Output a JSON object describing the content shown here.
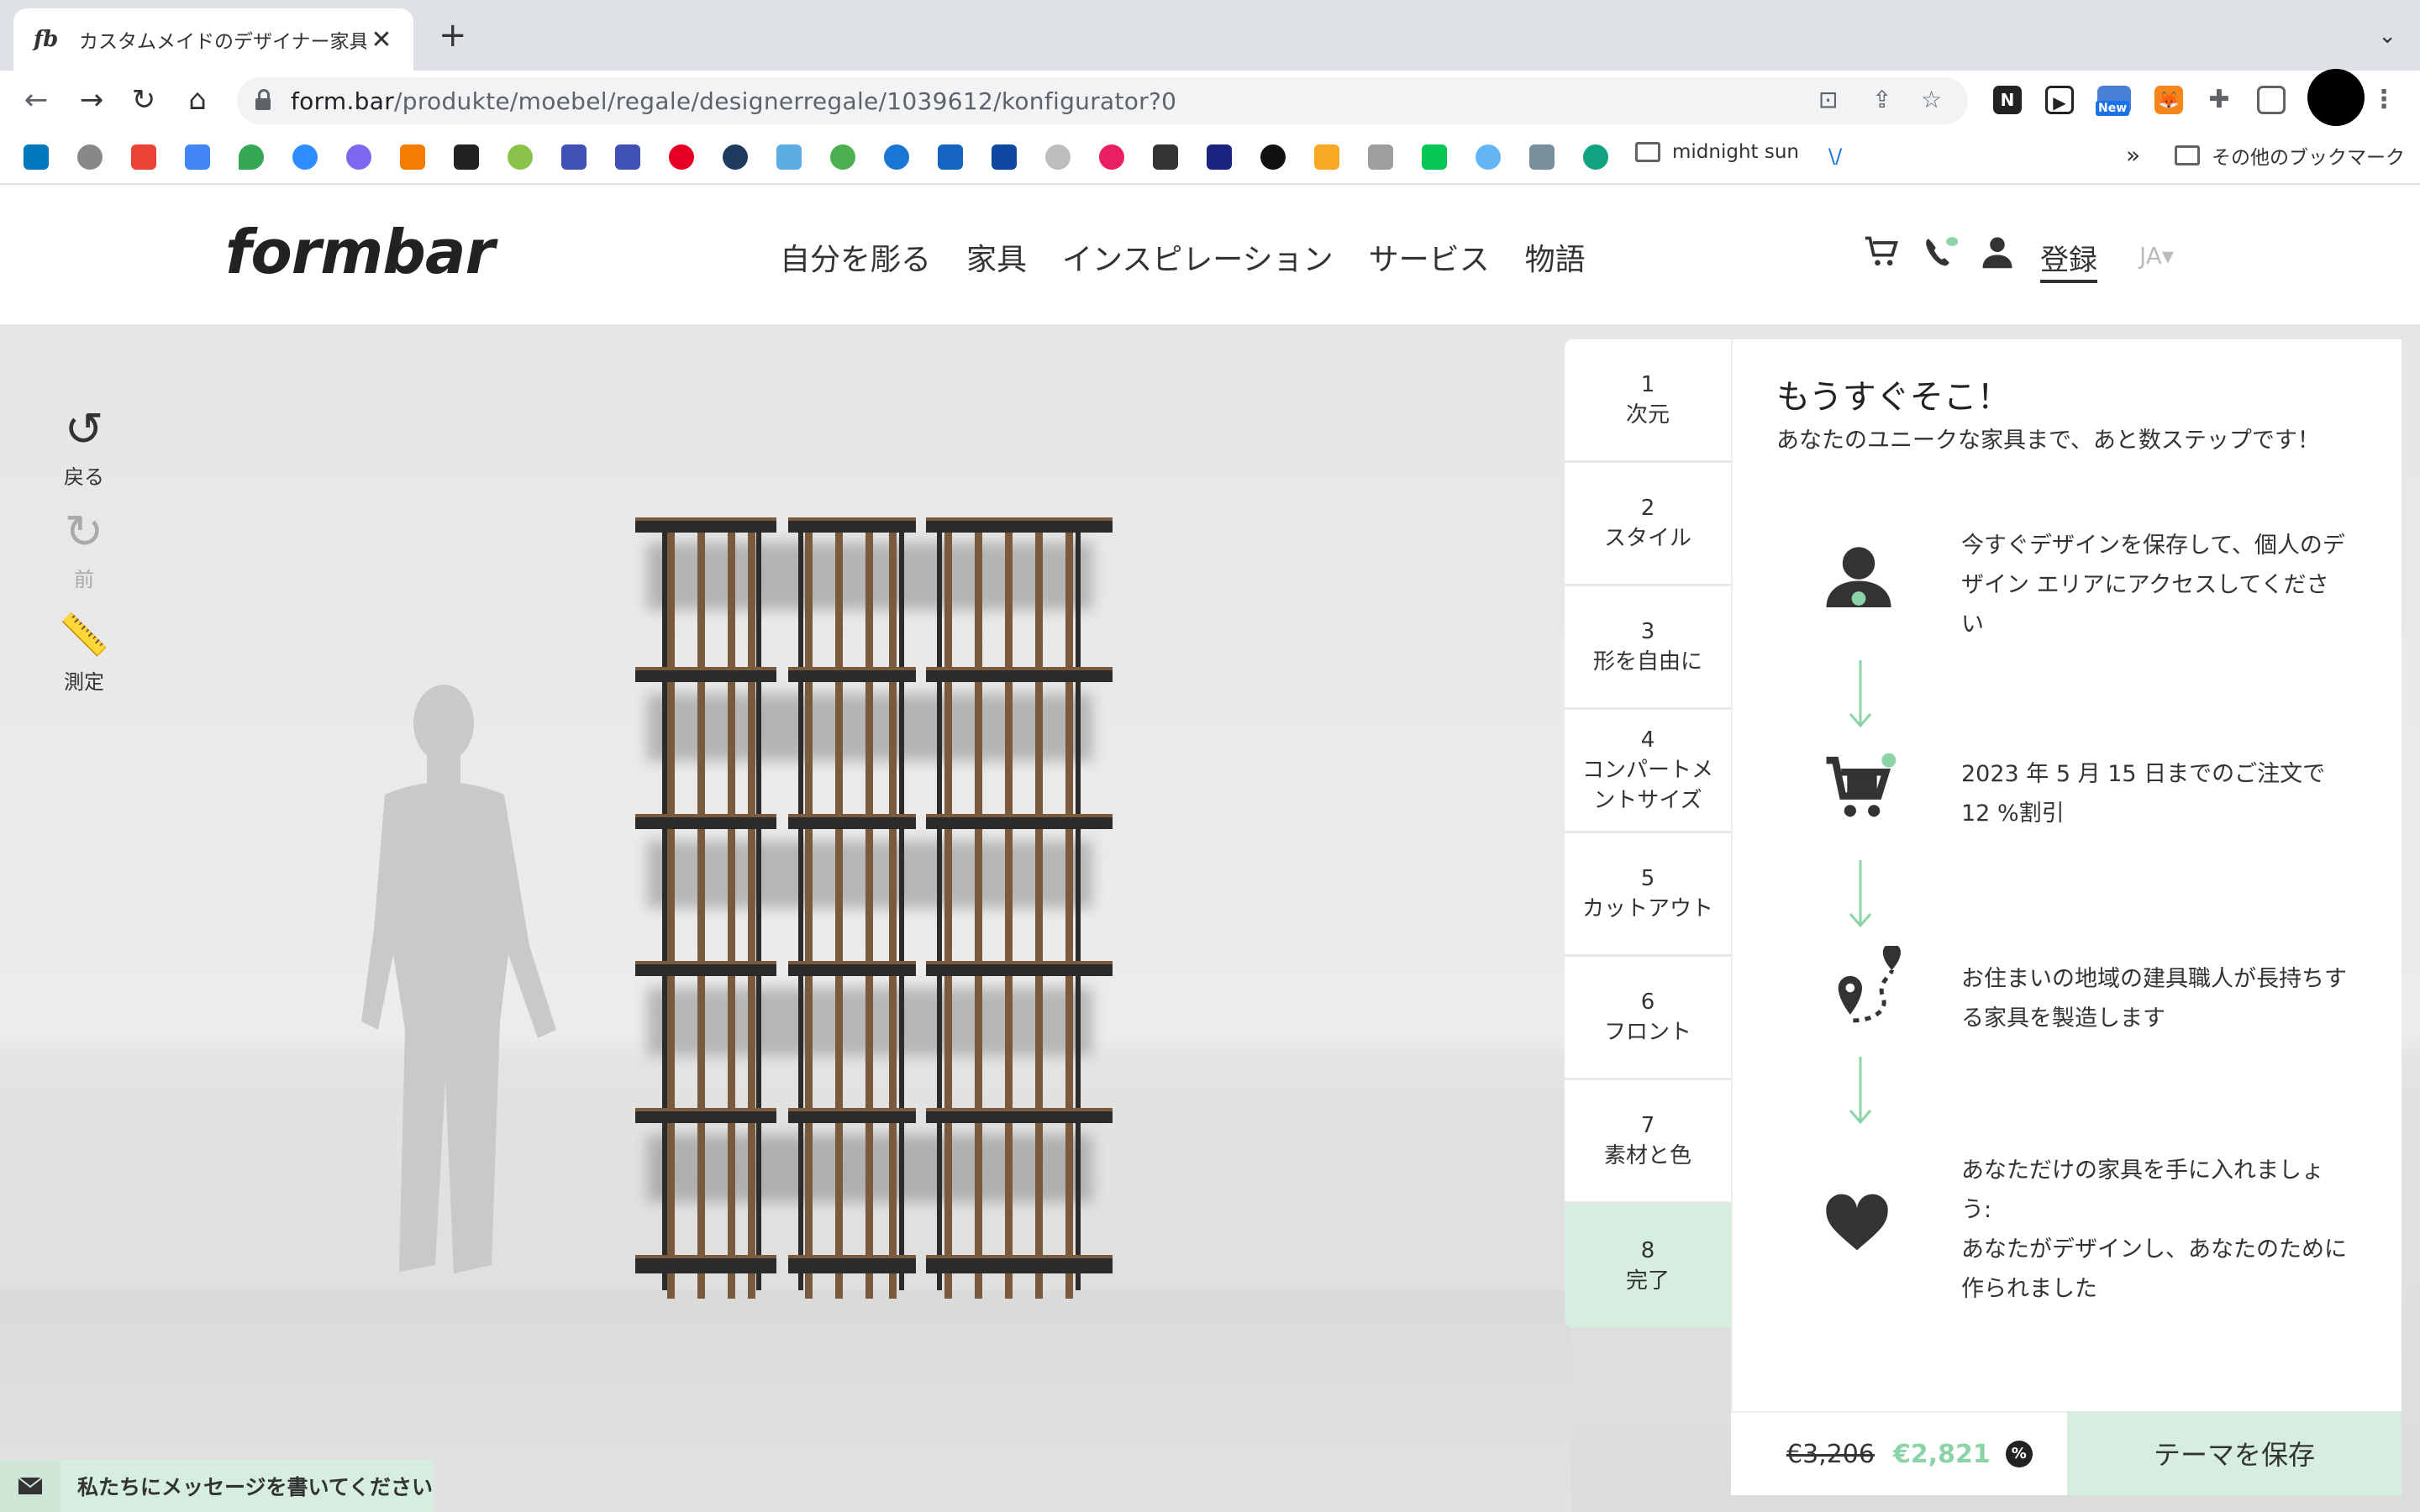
{
  "browser": {
    "tab_title": "カスタムメイドのデザイナー家具の",
    "tab_favicon": "fb",
    "url_host": "form.bar",
    "url_path": "/produkte/moebel/regale/designerregale/1039612/konfigurator?0",
    "extension_badge": "New",
    "bookmarks": {
      "folder_label": "midnight sun",
      "other_label": "その他のブックマーク"
    }
  },
  "header": {
    "logo": "formbar",
    "nav": [
      "自分を彫る",
      "家具",
      "インスピレーション",
      "サービス",
      "物語"
    ],
    "login": "登録",
    "lang": "JA▾"
  },
  "tools": {
    "undo": "戻る",
    "redo": "前",
    "measure": "測定"
  },
  "steps": [
    {
      "num": "1",
      "label": "次元"
    },
    {
      "num": "2",
      "label": "スタイル"
    },
    {
      "num": "3",
      "label": "形を自由に"
    },
    {
      "num": "4",
      "label": "コンパートメ\nントサイズ"
    },
    {
      "num": "5",
      "label": "カットアウト"
    },
    {
      "num": "6",
      "label": "フロント"
    },
    {
      "num": "7",
      "label": "素材と色"
    },
    {
      "num": "8",
      "label": "完了"
    }
  ],
  "panel": {
    "title": "もうすぐそこ！",
    "subtitle": "あなたのユニークな家具まで、あと数ステップです！",
    "features": [
      {
        "icon": "user-icon",
        "text": "今すぐデザインを保存して、個人のデザイン エリアにアクセスしてください"
      },
      {
        "icon": "cart-discount-icon",
        "text": "2023 年 5 月 15 日までのご注文で12 %割引"
      },
      {
        "icon": "route-map-icon",
        "text": "お住まいの地域の建具職人が長持ちする家具を製造します"
      },
      {
        "icon": "heart-icon",
        "text": "あなただけの家具を手に入れましょう:\nあなたがデザインし、あなたのために作られました"
      }
    ]
  },
  "price": {
    "old": "€3,206",
    "new": "€2,821",
    "badge": "%"
  },
  "save_button": "テーマを保存",
  "message_bar": "私たちにメッセージを書いてください",
  "colors": {
    "accent": "#d6eedf",
    "price_green": "#8cd4a8",
    "shelf_wood": "#7a5a3c",
    "shelf_dark": "#2b2b2b"
  }
}
